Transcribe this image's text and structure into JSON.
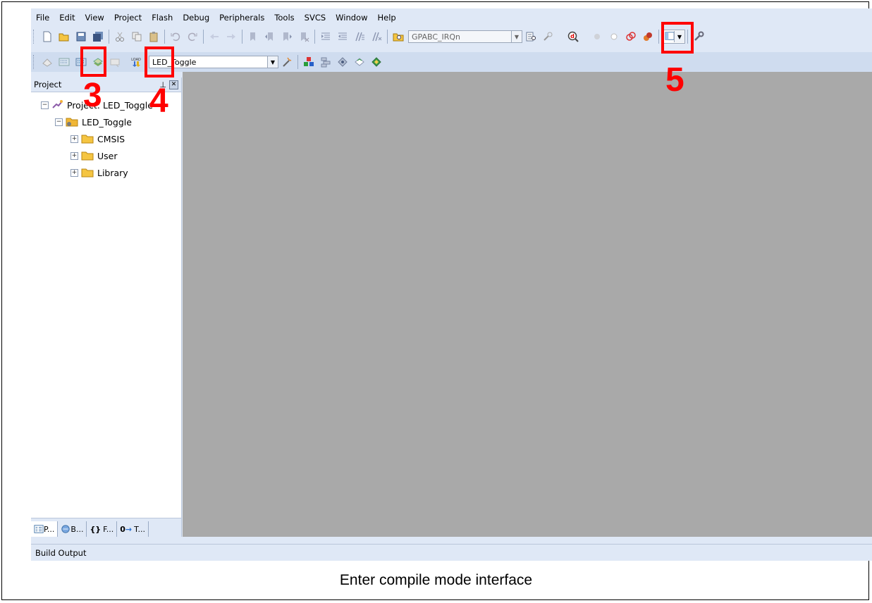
{
  "menu": [
    "File",
    "Edit",
    "View",
    "Project",
    "Flash",
    "Debug",
    "Peripherals",
    "Tools",
    "SVCS",
    "Window",
    "Help"
  ],
  "toolbar1": {
    "search_combo_value": "GPABC_IRQn",
    "icons": [
      "new-file-icon",
      "open-file-icon",
      "save-icon",
      "save-all-icon",
      "cut-icon",
      "copy-icon",
      "paste-icon",
      "undo-icon",
      "redo-icon",
      "navigate-back-icon",
      "navigate-forward-icon",
      "bookmark-icon",
      "bookmark-prev-icon",
      "bookmark-next-icon",
      "bookmark-clear-icon",
      "indent-icon",
      "unindent-icon",
      "comment-icon",
      "uncomment-icon",
      "find-in-files-icon"
    ],
    "right_icons": [
      "find-icon",
      "incremental-find-icon",
      "debug-session-icon",
      "breakpoint-insert-icon",
      "breakpoint-enable-icon",
      "breakpoint-disable-all-icon",
      "breakpoint-kill-all-icon",
      "window-layout-icon",
      "configure-icon"
    ]
  },
  "toolbar2": {
    "target_combo_value": "LED_Toggle",
    "icons": [
      "translate-icon",
      "build-icon",
      "rebuild-icon",
      "batch-build-icon",
      "stop-build-icon",
      "download-icon"
    ],
    "load_icon_text": "LOAD",
    "right_icons": [
      "target-options-icon",
      "manage-components-icon",
      "select-packs-icon",
      "pack-installer-icon",
      "manage-rte-icon",
      "run-time-env-icon"
    ]
  },
  "annotations": {
    "label3": "3",
    "label4": "4",
    "label5": "5"
  },
  "project_panel": {
    "title": "Project",
    "tree": [
      {
        "label": "Project: LED_Toggle",
        "level": 0
      },
      {
        "label": "LED_Toggle",
        "level": 1
      },
      {
        "label": "CMSIS",
        "level": 2
      },
      {
        "label": "User",
        "level": 2
      },
      {
        "label": "Library",
        "level": 2
      }
    ],
    "tabs": [
      "P...",
      "B...",
      "F...",
      "T..."
    ]
  },
  "build_output": "Build Output",
  "caption": "Enter compile mode interface",
  "colors": {
    "highlight": "#ff0000",
    "editor_bg": "#a9a9a9",
    "chrome_bg": "#dfe8f6"
  }
}
